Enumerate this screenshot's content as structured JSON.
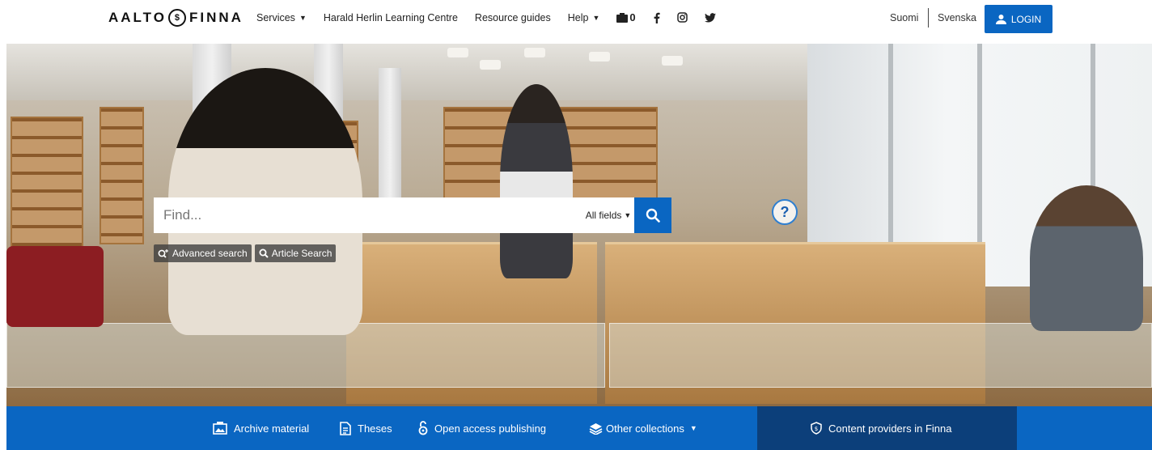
{
  "header": {
    "logo_text_left": "AALTO",
    "logo_text_right": "FINNA",
    "nav": {
      "services": "Services",
      "learning_centre": "Harald Herlin Learning Centre",
      "resource_guides": "Resource guides",
      "help": "Help",
      "bookbag_count": "0"
    },
    "lang_fi": "Suomi",
    "lang_sv": "Svenska",
    "login": "LOGIN"
  },
  "search": {
    "placeholder": "Find...",
    "type_selected": "All fields",
    "advanced": "Advanced search",
    "article": "Article Search"
  },
  "bottom_nav": {
    "archive": "Archive material",
    "theses": "Theses",
    "open_access": "Open access publishing",
    "other_collections": "Other collections",
    "content_providers": "Content providers in Finna"
  },
  "colors": {
    "primary": "#0a66c2",
    "dark_primary": "#0c3f7a"
  },
  "icons": [
    "photo-icon",
    "cart-icon",
    "facebook-icon",
    "instagram-icon",
    "twitter-icon",
    "search-icon",
    "help-icon",
    "user-icon",
    "archive-icon",
    "document-icon",
    "open-access-icon",
    "collections-icon",
    "finna-shield-icon"
  ]
}
